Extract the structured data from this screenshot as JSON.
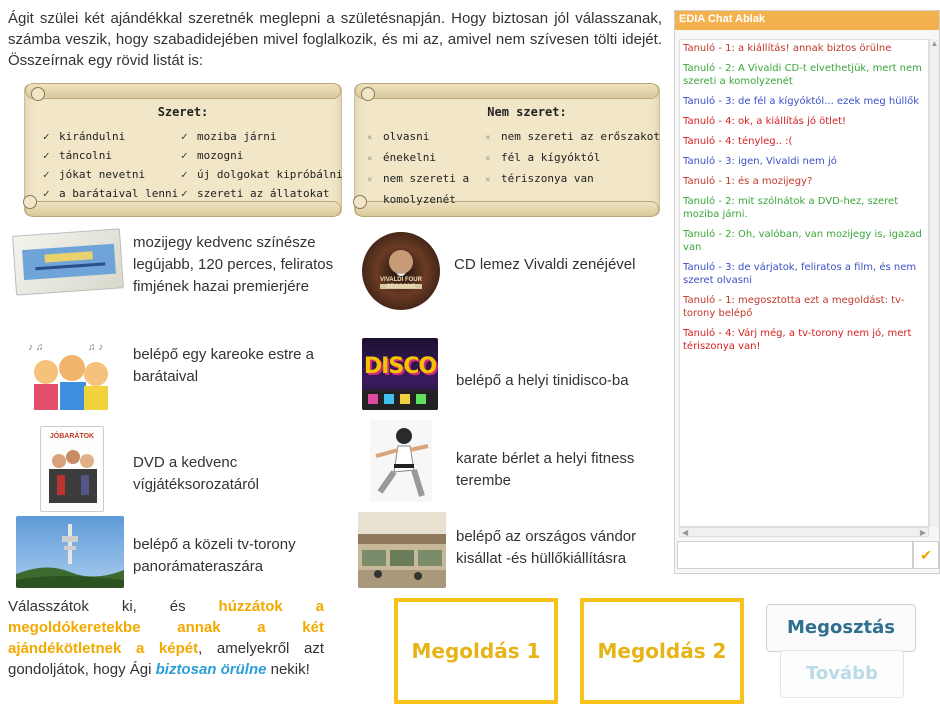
{
  "intro": "Ágit szülei két ajándékkal szeretnék meglepni a születésnapján. Hogy biztosan jól válasszanak, számba veszik, hogy szabadidejében mivel foglalkozik, és mi az, amivel nem szívesen tölti idejét. Összeírnak egy rövid listát is:",
  "likes": {
    "title": "Szeret:",
    "col1": [
      "kirándulni",
      "táncolni",
      "jókat nevetni",
      "a barátaival lenni"
    ],
    "col2": [
      "moziba járni",
      "mozogni",
      "új dolgokat kipróbálni",
      "szereti az állatokat"
    ]
  },
  "dislikes": {
    "title": "Nem szeret:",
    "col1": [
      "olvasni",
      "énekelni",
      "nem szereti a",
      "komolyzenét"
    ],
    "col2": [
      "nem szereti az erőszakot",
      "fél a kígyóktól",
      "tériszonya van"
    ]
  },
  "gifts": [
    "mozijegy kedvenc színésze legújabb, 120 perces, feliratos fimjének hazai premierjére",
    "CD lemez Vivaldi zenéjével",
    "belépő egy kareoke estre a barátaival",
    "belépő a helyi tinidisco-ba",
    "DVD a kedvenc vígjátéksorozatáról",
    "karate bérlet a helyi fitness terembe",
    "belépő a közeli tv-torony panorámateraszára",
    "belépő az országos vándor kisállat -és hüllőkiállításra"
  ],
  "pictures": {
    "cd_title": "VIVALDI FOUR SEASONS",
    "disco": "DISCO",
    "dvd": "JÓBARÁTOK"
  },
  "instructions": {
    "p1": "Válasszátok ki, és ",
    "p2": "húzzátok a megoldókeretekbe annak a két ajándékötletnek a képét",
    "p3": ", amelyekről azt gondoljátok, hogy Ági ",
    "p4": "biztosan örülne",
    "p5": " nekik!"
  },
  "solutions": {
    "s1": "Megoldás 1",
    "s2": "Megoldás 2"
  },
  "buttons": {
    "share": "Megosztás",
    "next": "Tovább"
  },
  "chat": {
    "title": "EDIA Chat Ablak",
    "messages": [
      {
        "text": "Tanuló - 1: a kiállítás! annak biztos örülne",
        "color": "#c0392b"
      },
      {
        "text": "Tanuló - 2: A Vivaldi CD-t elvethetjük, mert nem szereti a komolyzenét",
        "color": "#3aa63a"
      },
      {
        "text": "Tanuló - 3: de fél a kígyóktól... ezek meg hüllők",
        "color": "#3b4fc4"
      },
      {
        "text": "Tanuló - 4: ok, a kiállítás jó ötlet!",
        "color": "#d62020"
      },
      {
        "text": "Tanuló - 4: tényleg.. :(",
        "color": "#d62020"
      },
      {
        "text": "Tanuló - 3: igen, Vivaldi nem jó",
        "color": "#3b4fc4"
      },
      {
        "text": "Tanuló - 1: és a mozijegy?",
        "color": "#c0392b"
      },
      {
        "text": "Tanuló - 2: mit szólnátok a DVD-hez, szeret moziba járni.",
        "color": "#3aa63a"
      },
      {
        "text": "Tanuló - 2: Oh, valóban, van mozijegy is, igazad van",
        "color": "#3aa63a"
      },
      {
        "text": "Tanuló - 3: de várjatok, feliratos a film, és nem szeret olvasni",
        "color": "#3b4fc4"
      },
      {
        "text": "Tanuló - 1: megosztotta ezt a megoldást: tv-torony belépő",
        "color": "#c0392b"
      },
      {
        "text": "Tanuló - 4: Várj még, a tv-torony nem jó, mert tériszonya van!",
        "color": "#d62020"
      }
    ]
  },
  "colors": {
    "accent": "#f7c21a",
    "share": "#2f6f8f",
    "next": "#b9dbe7"
  }
}
